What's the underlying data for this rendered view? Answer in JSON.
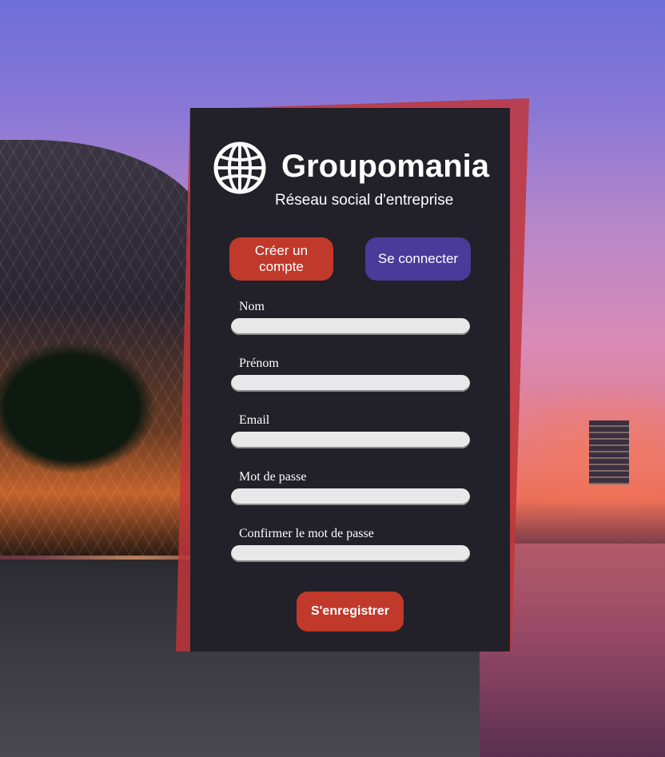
{
  "brand": {
    "title": "Groupomania",
    "subtitle": "Réseau social d'entreprise",
    "icon": "globe-icon"
  },
  "tabs": {
    "create_label": "Créer un compte",
    "login_label": "Se connecter"
  },
  "form": {
    "fields": [
      {
        "label": "Nom",
        "value": ""
      },
      {
        "label": "Prénom",
        "value": ""
      },
      {
        "label": "Email",
        "value": ""
      },
      {
        "label": "Mot de passe",
        "value": ""
      },
      {
        "label": "Confirmer le mot de passe",
        "value": ""
      }
    ],
    "submit_label": "S'enregistrer"
  },
  "colors": {
    "card": "#222028",
    "accent_red": "#c0392b",
    "accent_purple": "#4a3a9a"
  }
}
